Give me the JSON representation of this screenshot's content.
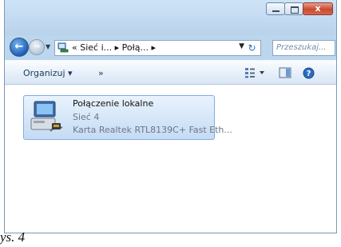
{
  "window": {
    "close_label": "x"
  },
  "nav": {
    "back_icon": "back-arrow-icon",
    "forward_icon": "forward-arrow-icon",
    "address_path": "« Sieć i... ▸ Połą... ▸",
    "search_placeholder": "Przeszukaj..."
  },
  "toolbar": {
    "organize_label": "Organizuj ▾",
    "more_label": "»"
  },
  "item": {
    "name": "Połączenie lokalne",
    "network": "Sieć 4",
    "adapter": "Karta Realtek RTL8139C+ Fast Eth..."
  },
  "caption": "ys. 4",
  "colors": {
    "accent": "#2a6cc6",
    "selection_bg": "#c4dbf5",
    "selection_border": "#84acdd"
  }
}
